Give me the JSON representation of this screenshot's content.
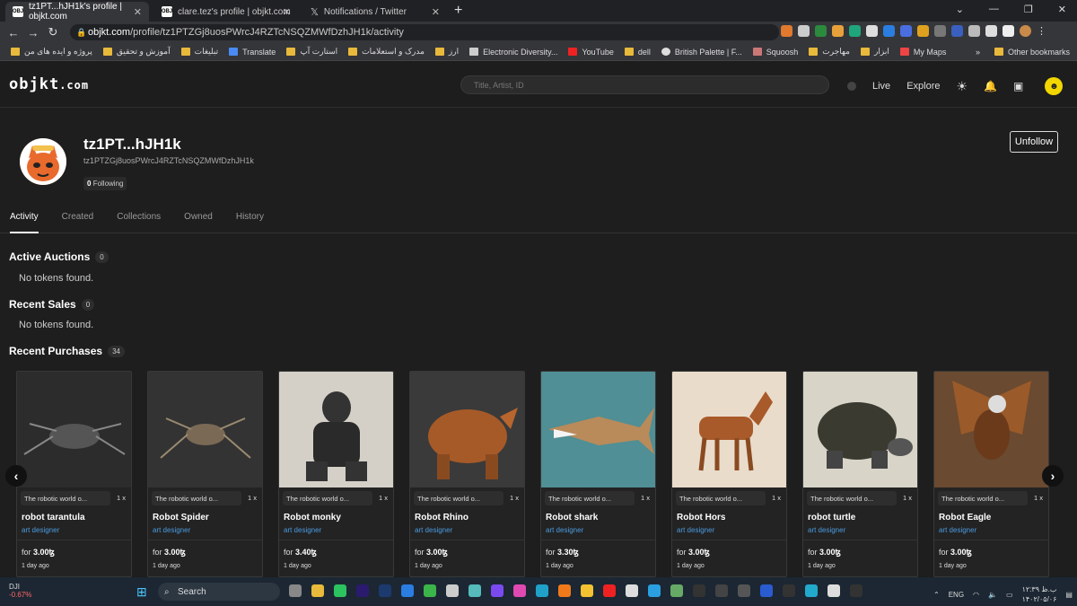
{
  "browser": {
    "tabs": [
      {
        "title": "tz1PT...hJH1k's profile | objkt.com",
        "favicon": "objkt"
      },
      {
        "title": "clare.tez's profile | objkt.com",
        "favicon": "objkt"
      },
      {
        "title": "Notifications / Twitter",
        "favicon": "x-icon"
      }
    ],
    "new_tab": "+",
    "url_host": "objkt.com",
    "url_path": "/profile/tz1PTZGj8uosPWrcJ4RZTcNSQZMWfDzhJH1k/activity",
    "bookmarks": [
      "پروژه و ایده های من",
      "آموزش و تحقیق",
      "تبلیغات",
      "Translate",
      "استارت آپ",
      "مدرک و استعلامات",
      "ارز",
      "Electronic Diversity...",
      "YouTube",
      "dell",
      "British Palette | F...",
      "Squoosh",
      "مهاجرت",
      "ابزار",
      "My Maps",
      "Other bookmarks"
    ]
  },
  "site": {
    "logo": "objkt",
    "logo_suffix": ".com",
    "search_placeholder": "Title, Artist, ID",
    "nav": {
      "live": "Live",
      "explore": "Explore"
    }
  },
  "profile": {
    "name": "tz1PT...hJH1k",
    "address": "tz1PTZGj8uosPWrcJ4RZTcNSQZMWfDzhJH1k",
    "following_count": "0",
    "following_label": "Following",
    "unfollow": "Unfollow",
    "tabs": [
      "Activity",
      "Created",
      "Collections",
      "Owned",
      "History"
    ],
    "active_tab": "Activity"
  },
  "sections": {
    "auctions": {
      "title": "Active Auctions",
      "count": "0",
      "empty": "No tokens found."
    },
    "sales": {
      "title": "Recent Sales",
      "count": "0",
      "empty": "No tokens found."
    },
    "purchases": {
      "title": "Recent Purchases",
      "count": "34"
    }
  },
  "purchases": [
    {
      "collection": "The robotic world o...",
      "qty": "1 x",
      "title": "robot tarantula",
      "artist": "art designer",
      "price_prefix": "for",
      "price": "3.00ꜩ",
      "time": "1 day ago",
      "bg": "#2c2c2c"
    },
    {
      "collection": "The robotic world o...",
      "qty": "1 x",
      "title": "Robot Spider",
      "artist": "art designer",
      "price_prefix": "for",
      "price": "3.00ꜩ",
      "time": "1 day ago",
      "bg": "#333"
    },
    {
      "collection": "The robotic world o...",
      "qty": "1 x",
      "title": "Robot monky",
      "artist": "art designer",
      "price_prefix": "for",
      "price": "3.40ꜩ",
      "time": "1 day ago",
      "bg": "#d4d0c8"
    },
    {
      "collection": "The robotic world o...",
      "qty": "1 x",
      "title": "Robot Rhino",
      "artist": "art designer",
      "price_prefix": "for",
      "price": "3.00ꜩ",
      "time": "1 day ago",
      "bg": "#3a3a3a"
    },
    {
      "collection": "The robotic world o...",
      "qty": "1 x",
      "title": "Robot shark",
      "artist": "art designer",
      "price_prefix": "for",
      "price": "3.30ꜩ",
      "time": "1 day ago",
      "bg": "#4f8f95"
    },
    {
      "collection": "The robotic world o...",
      "qty": "1 x",
      "title": "Robot Hors",
      "artist": "art designer",
      "price_prefix": "for",
      "price": "3.00ꜩ",
      "time": "1 day ago",
      "bg": "#e9dccb"
    },
    {
      "collection": "The robotic world o...",
      "qty": "1 x",
      "title": "robot turtle",
      "artist": "art designer",
      "price_prefix": "for",
      "price": "3.00ꜩ",
      "time": "1 day ago",
      "bg": "#d8d4c8"
    },
    {
      "collection": "The robotic world o...",
      "qty": "1 x",
      "title": "Robot Eagle",
      "artist": "art designer",
      "price_prefix": "for",
      "price": "3.00ꜩ",
      "time": "1 day ago",
      "bg": "#6a4a30"
    }
  ],
  "taskbar": {
    "weather_label": "DJI",
    "weather_value": "-0.67%",
    "search": "Search",
    "lang": "ENG",
    "time": "۱۲:۳۹ ب.ظ",
    "date": "۱۴۰۲/۰۵/۰۶"
  }
}
